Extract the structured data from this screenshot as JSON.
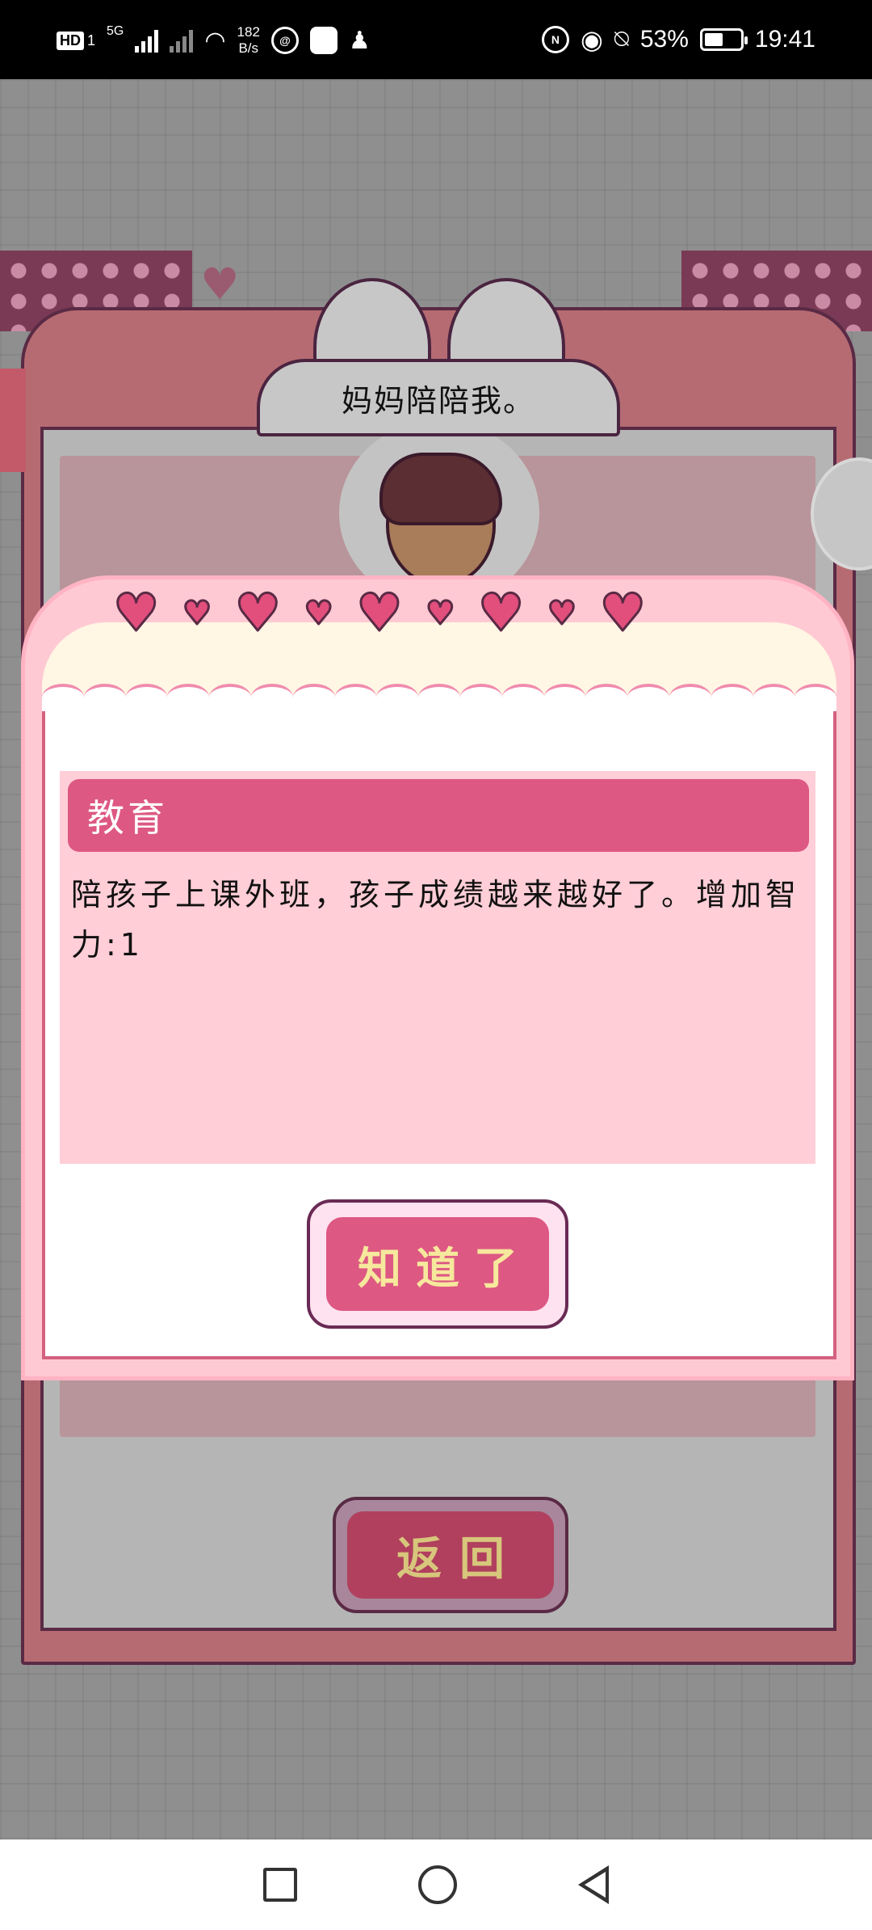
{
  "status_bar": {
    "hd_badge": "HD",
    "sim_label": "1",
    "network": "5G",
    "speed_value": "182",
    "speed_unit": "B/s",
    "battery_percent": "53%",
    "battery_level": 0.53,
    "time": "19:41",
    "icons": [
      "hd-icon",
      "5g-signal-icon",
      "no-signal-icon",
      "wifi-icon",
      "swirl-app-icon",
      "bag-app-icon",
      "qq-penguin-icon",
      "nfc-icon",
      "eye-icon",
      "mute-bell-icon",
      "battery-icon"
    ]
  },
  "background": {
    "accent_color": "#b66b72",
    "back_button_label": "返回"
  },
  "character": {
    "speech": "妈妈陪陪我。"
  },
  "dialog": {
    "heart_count": 9,
    "title": "教育",
    "message": "陪孩子上课外班，孩子成绩越来越好了。增加智力:1",
    "confirm_label": "知道了",
    "colors": {
      "header": "#dd5883",
      "body": "#ffced7",
      "button_text": "#f6e89c"
    }
  },
  "nav_bar": {
    "icons": [
      "recent-apps-icon",
      "home-icon",
      "back-icon"
    ]
  }
}
